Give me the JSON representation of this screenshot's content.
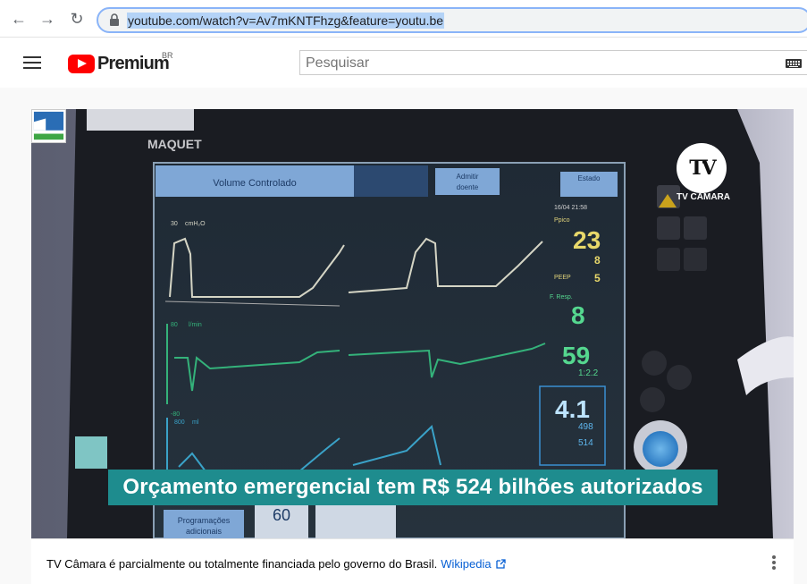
{
  "browser": {
    "url": "youtube.com/watch?v=Av7mKNTFhzg&feature=youtu.be"
  },
  "header": {
    "logo_text": "Premium",
    "country_code": "BR",
    "search_placeholder": "Pesquisar"
  },
  "video": {
    "caption": "Orçamento emergencial tem R$ 524 bilhões autorizados",
    "channel_logo_text": "TV",
    "channel_logo_label": "TV CÂMARA",
    "monitor": {
      "brand": "MAQUET",
      "mode": "Volume Controlado",
      "button_admit_line1": "Admitir",
      "button_admit_line2": "doente",
      "button_state_line1": "Estado",
      "datetime": "16/04  21:58",
      "ppico_label": "Ppico",
      "ppico": "23",
      "pausa": "8",
      "peep_label": "PEEP",
      "peep": "5",
      "fresp_label": "F. Resp.",
      "fresp": "8",
      "o2": "59",
      "ie": "1:2.2",
      "vol": "4.1",
      "v1": "498",
      "v2": "514",
      "scale_pressure": "30",
      "unit_pressure": "cmH₂O",
      "scale_flow": "80",
      "unit_flow": "l/min",
      "scale_flow_neg": "-80",
      "scale_vol": "800",
      "unit_vol": "ml",
      "prog_label_line1": "Programações",
      "prog_label_line2": "adicionais",
      "bottom_value": "60"
    }
  },
  "info_bar": {
    "text": "TV Câmara é parcialmente ou totalmente financiada pelo governo do Brasil.",
    "link": "Wikipedia"
  }
}
